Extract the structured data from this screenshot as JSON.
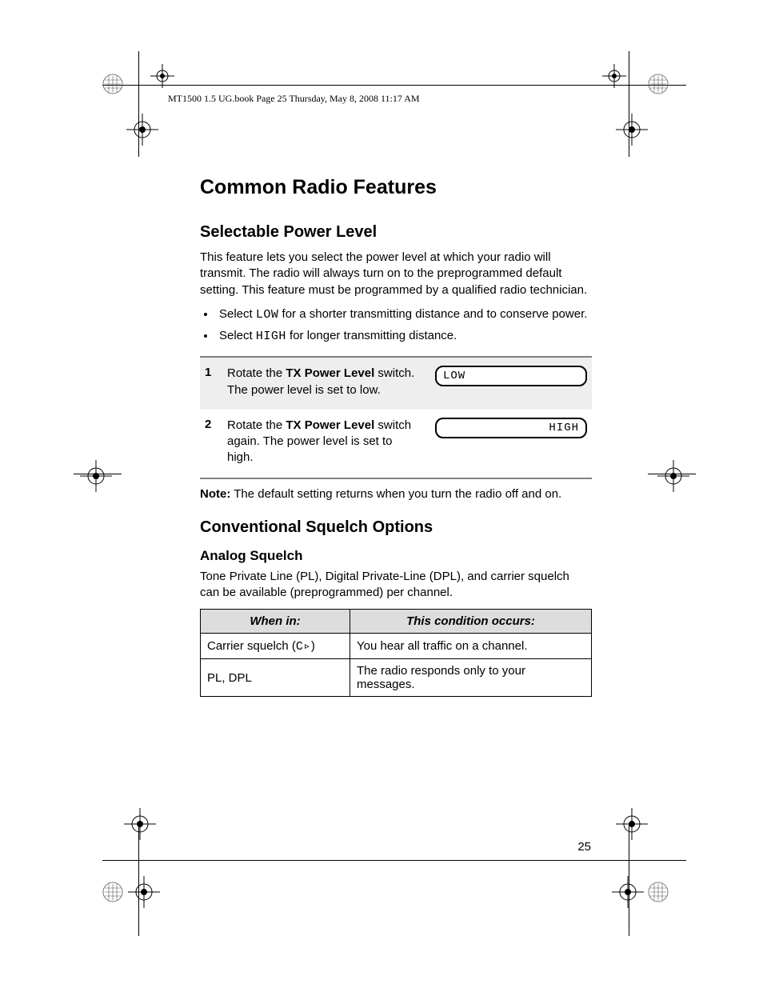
{
  "header": "MT1500 1.5 UG.book  Page 25  Thursday, May 8, 2008  11:17 AM",
  "title": "Common Radio Features",
  "section1": {
    "heading": "Selectable Power Level",
    "intro": "This feature lets you select the power level at which your radio will transmit. The radio will always turn on to the preprogrammed default setting. This feature must be programmed by a qualified radio technician.",
    "bullet1_pre": "Select ",
    "bullet1_code": "LOW",
    "bullet1_post": " for a shorter transmitting distance and to conserve power.",
    "bullet2_pre": "Select ",
    "bullet2_code": "HIGH",
    "bullet2_post": " for longer transmitting distance.",
    "steps": [
      {
        "num": "1",
        "pre": "Rotate the ",
        "bold": "TX Power Level",
        "post": " switch. The power level is set to low.",
        "display": "LOW",
        "align": "left"
      },
      {
        "num": "2",
        "pre": "Rotate the ",
        "bold": "TX Power Level",
        "post": " switch again. The power level is set to high.",
        "display": "HIGH",
        "align": "right"
      }
    ],
    "note_label": "Note:",
    "note_text": "  The default setting returns when you turn the radio off and on."
  },
  "section2": {
    "heading": "Conventional Squelch Options",
    "sub": "Analog Squelch",
    "intro": "Tone Private Line (PL), Digital Private-Line (DPL), and carrier squelch can be available (preprogrammed) per channel.",
    "table": {
      "head1": "When in:",
      "head2": "This condition occurs:",
      "rows": [
        {
          "c1_pre": "Carrier squelch (",
          "c1_sym": "C▹",
          "c1_post": ")",
          "c2": "You hear all traffic on a channel."
        },
        {
          "c1_pre": "PL, DPL",
          "c1_sym": "",
          "c1_post": "",
          "c2": "The radio responds only to your messages."
        }
      ]
    }
  },
  "page_number": "25"
}
